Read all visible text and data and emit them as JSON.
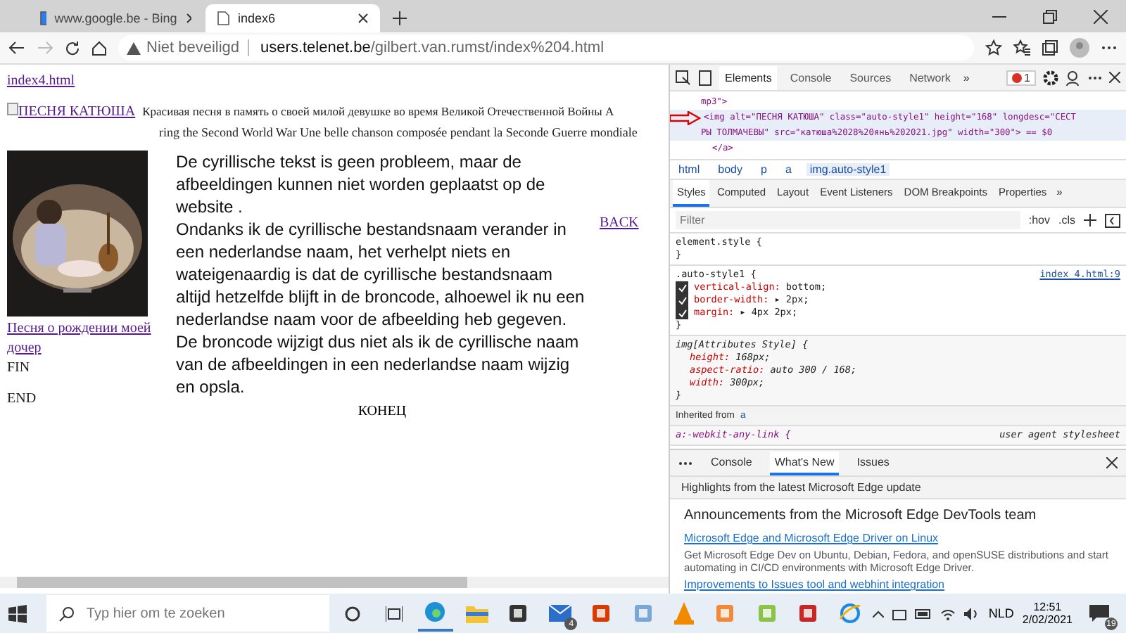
{
  "browser": {
    "tabs": [
      {
        "title": "www.google.be - Bing",
        "selected": false
      },
      {
        "title": "index6",
        "selected": true
      }
    ],
    "address": {
      "warning": "Niet beveiligd",
      "host": "users.telenet.be",
      "path": "/gilbert.van.rumst/index%204.html"
    }
  },
  "page": {
    "top_link": "index4.html",
    "image_alt_link": "ПЕСНЯ КАТЮША",
    "russian_line": "Красивая песня в память о своей милой девушке во время Великой Отечественной Войны  A",
    "second_line": "ring the Second World War   Une belle chanson composée pendant la Seconde Guerre mondiale",
    "song_link": [
      "Песня о рождении моей",
      "дочер"
    ],
    "fin": "FIN",
    "end": "END",
    "back_link": "BACK",
    "konets": "КОНЕЦ",
    "paragraphs": [
      "De cyrillische tekst is geen probleem, maar de afbeeldingen kunnen niet worden geplaatst op de website .",
      "Ondanks ik de cyrillische bestandsnaam verander in een nederlandse naam, het verhelpt niets en wateigenaardig is dat de cyrillische bestandsnaam altijd hetzelfde blijft in de broncode, alhoewel ik nu een nederlandse naam voor de afbeelding heb gegeven. De broncode wijzigt dus niet als ik de cyrillische naam van de afbeeldingen in een nederlandse naam wijzig en opsla."
    ]
  },
  "devtools": {
    "tabs": [
      {
        "label": "Elements",
        "selected": true
      },
      {
        "label": "Console",
        "selected": false
      },
      {
        "label": "Sources",
        "selected": false
      },
      {
        "label": "Network",
        "selected": false
      }
    ],
    "more": "»",
    "error_count": "1",
    "dom_lines": [
      {
        "text": "mp3\">",
        "indent": false,
        "selected": false
      },
      {
        "text": "<img alt=\"ПЕСНЯ КАТЮША\" class=\"auto-style1\" height=\"168\" longdesc=\"СЕСТ",
        "indent": true,
        "selected": true
      },
      {
        "text": "РЫ ТОЛМАЧЕВЫ\" src=\"катюша%2028%20янь%202021.jpg\" width=\"300\"> == $0",
        "indent": false,
        "selected": true
      },
      {
        "text": "</a>",
        "indent": true,
        "selected": false
      }
    ],
    "breadcrumbs": [
      {
        "label": "html",
        "selected": false
      },
      {
        "label": "body",
        "selected": false
      },
      {
        "label": "p",
        "selected": false
      },
      {
        "label": "a",
        "selected": false
      },
      {
        "label": "img.auto-style1",
        "selected": true
      }
    ],
    "style_tabs": [
      {
        "label": "Styles",
        "selected": true
      },
      {
        "label": "Computed",
        "selected": false
      },
      {
        "label": "Layout",
        "selected": false
      },
      {
        "label": "Event Listeners",
        "selected": false
      },
      {
        "label": "DOM Breakpoints",
        "selected": false
      },
      {
        "label": "Properties",
        "selected": false
      }
    ],
    "style_more": "»",
    "filter": {
      "placeholder": "Filter"
    },
    "hov": ":hov",
    "cls": ".cls",
    "rules": [
      {
        "selector": "element.style {",
        "italic": false,
        "close": "}"
      },
      {
        "selector": ".auto-style1 {",
        "source": "index 4.html:9",
        "italic": false,
        "props": [
          {
            "kind": "check",
            "name": "vertical-align:",
            "value": "bottom;",
            "checked": true
          },
          {
            "kind": "check",
            "name": "border-width:",
            "value": "▸ 2px;",
            "checked": true
          },
          {
            "kind": "check",
            "name": "margin:",
            "value": "▸ 4px 2px;",
            "checked": true
          }
        ],
        "close": "}"
      },
      {
        "selector": "img[Attributes Style] {",
        "italic": true,
        "props": [
          {
            "kind": "plain",
            "name": "height:",
            "value": "168px;"
          },
          {
            "kind": "plain",
            "name": "aspect-ratio:",
            "value": "auto 300 / 168;"
          },
          {
            "kind": "plain",
            "name": "width:",
            "value": "300px;"
          }
        ],
        "close": "}"
      }
    ],
    "inherited": {
      "label": "Inherited from",
      "element": "a"
    },
    "ua_rule": {
      "selector": "a:-webkit-any-link {",
      "source": "user agent stylesheet"
    },
    "drawer": {
      "tabs": [
        {
          "label": "Console",
          "selected": false
        },
        {
          "label": "What's New",
          "selected": true
        },
        {
          "label": "Issues",
          "selected": false
        }
      ],
      "highlight": "Highlights from the latest Microsoft Edge update",
      "heading": "Announcements from the Microsoft Edge DevTools team",
      "items": [
        {
          "link": "Microsoft Edge and Microsoft Edge Driver on Linux",
          "text": "Get Microsoft Edge Dev on Ubuntu, Debian, Fedora, and openSUSE distributions and start automating in CI/CD environments with Microsoft Edge Driver."
        },
        {
          "link": "Improvements to Issues tool and webhint integration"
        }
      ]
    }
  },
  "taskbar": {
    "search": {
      "placeholder": "Typ hier om te zoeken"
    },
    "mail_badge": "4",
    "language": "NLD",
    "time": "12:51",
    "date": "2/02/2021",
    "notifications": "19"
  }
}
